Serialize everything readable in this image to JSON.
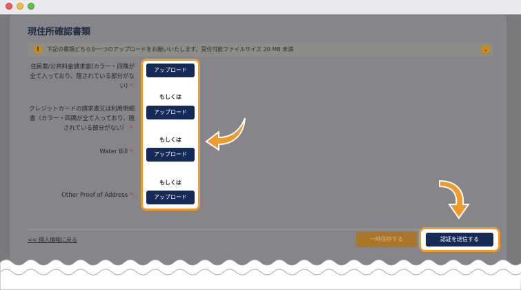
{
  "window": {
    "controls": [
      "close",
      "minimize",
      "maximize"
    ]
  },
  "page": {
    "heading": "現住所確認書類",
    "notice": "下記の書類どちらか一つのアップロードをお願いいたします。受付可能ファイルサイズ 20 MB 未満",
    "notice_icon": "info-icon",
    "toggle_icon": "chevron-down-icon"
  },
  "documents": [
    {
      "label_lines": [
        "住民票/公共料金請求書(カラー・四隅が",
        "全て入っており、隠されている部分がな",
        "い)"
      ],
      "required_mark": "*:",
      "button": "アップロード"
    },
    {
      "label_lines": [
        "クレジットカードの請求書又は利用明細",
        "書（カラー・四隅が全て入っており、隠",
        "されている部分がない）"
      ],
      "required_mark": "*:",
      "button": "アップロード"
    },
    {
      "label_lines": [
        "Water Bill"
      ],
      "required_mark": "*:",
      "button": "アップロード"
    },
    {
      "label_lines": [
        "Other Proof of Address"
      ],
      "required_mark": "*:",
      "button": "アップロード"
    }
  ],
  "separators": [
    "もしくは",
    "もしくは",
    "もしくは"
  ],
  "footer": {
    "back_link": "<< 個人情報に戻る",
    "save_button": "一時保存する",
    "submit_button": "認証を送信する"
  },
  "colors": {
    "accent": "#ef9a2b",
    "primary_button": "#152a57",
    "save_button": "#a8752a"
  }
}
